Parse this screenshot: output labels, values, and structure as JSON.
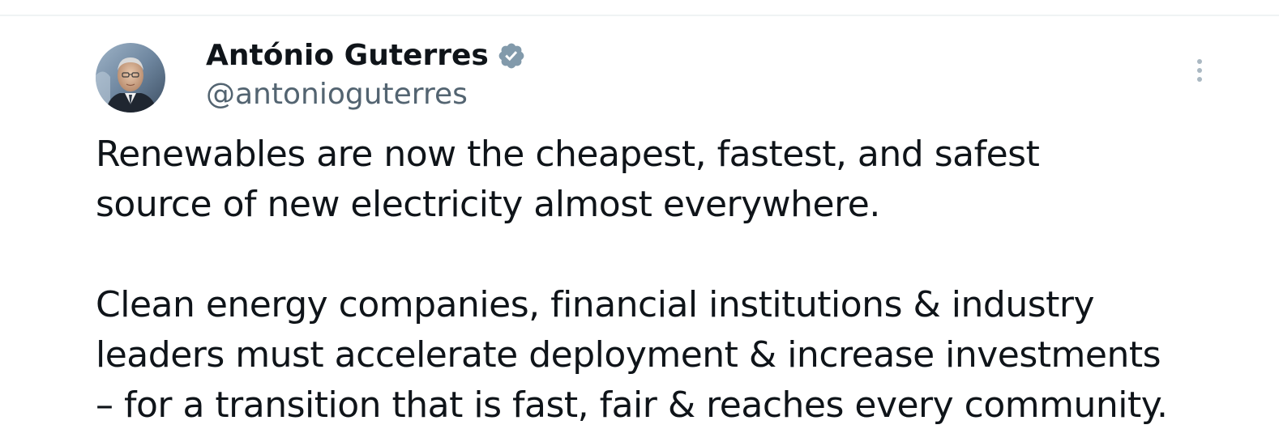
{
  "author": {
    "display_name": "António Guterres",
    "handle": "@antonioguterres",
    "verified": true,
    "badge_color": "#829aab"
  },
  "tweet": {
    "paragraph1": [
      "Renewables are now the cheapest, fastest, and safest",
      "source of new electricity almost everywhere."
    ],
    "paragraph2": [
      "Clean energy companies, financial institutions & industry",
      "leaders must accelerate deployment & increase investments",
      "– for a transition that is fast, fair & reaches every community."
    ]
  },
  "icons": {
    "more": "more-vertical-icon",
    "verified": "verified-badge-icon",
    "avatar": "profile-photo"
  },
  "colors": {
    "text_primary": "#0f1419",
    "text_secondary": "#536471",
    "divider": "#eff3f4",
    "more_icon": "#aab8c2"
  }
}
